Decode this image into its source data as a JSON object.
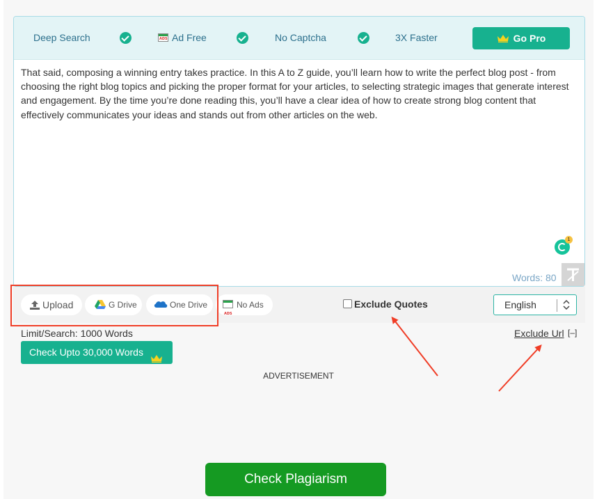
{
  "features": {
    "deep_search": "Deep Search",
    "ad_free": "Ad Free",
    "no_captcha": "No Captcha",
    "faster": "3X Faster",
    "go_pro": "Go Pro"
  },
  "editor": {
    "text": "That said, composing a winning entry takes practice. In this A to Z guide, you’ll learn how to write the perfect blog post - from choosing the right blog topics and picking the proper format for your articles, to selecting strategic images that generate interest and engagement. By the time you’re done reading this, you’ll have a clear idea of how to create strong blog content that effectively communicates your ideas and stands out from other articles on the web.",
    "words_label": "Words: 80",
    "grammarly_count": "1"
  },
  "toolbar": {
    "upload": "Upload",
    "gdrive": "G Drive",
    "onedrive": "One Drive",
    "no_ads": "No Ads",
    "exclude_quotes": "Exclude Quotes",
    "language": "English"
  },
  "limits": {
    "limit_text": "Limit/Search: 1000 Words",
    "check_upto": "Check Upto 30,000 Words",
    "exclude_url": "Exclude Url",
    "exclude_url_toggle": "[–]"
  },
  "advertisement": "ADVERTISEMENT",
  "check_button": "Check Plagiarism",
  "colors": {
    "accent": "#17b18f",
    "feature_bar": "#e3f4f6",
    "primary_button": "#159a22",
    "annotation_red": "#f03d26"
  }
}
